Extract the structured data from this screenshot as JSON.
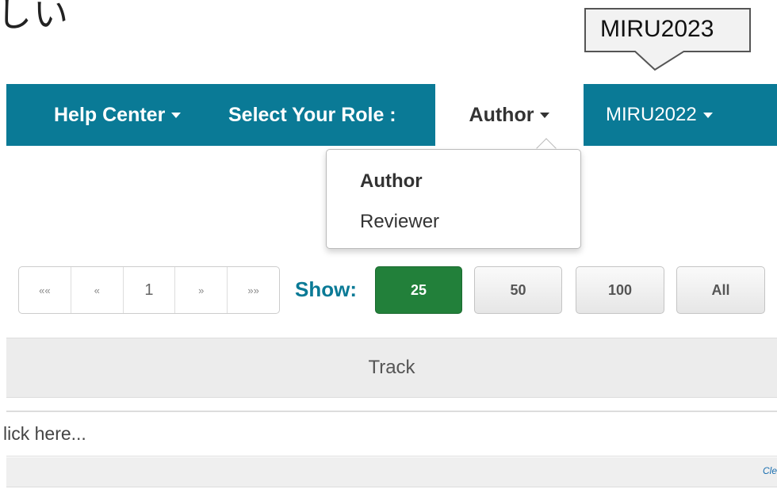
{
  "corner_text": "しい",
  "callout": {
    "text": "MIRU2023"
  },
  "navbar": {
    "help_center": "Help Center",
    "select_role_label": "Select Your Role :",
    "role_selected": "Author",
    "conference": "MIRU2022"
  },
  "role_dropdown": {
    "items": [
      "Author",
      "Reviewer"
    ]
  },
  "pagination": {
    "first": "««",
    "prev": "«",
    "page": "1",
    "next": "»",
    "last": "»»"
  },
  "show": {
    "label": "Show:",
    "options": [
      "25",
      "50",
      "100",
      "All"
    ],
    "selected": "25"
  },
  "table": {
    "column_header": "Track",
    "filter_placeholder": "lick here...",
    "clear_link": "Cle"
  },
  "colors": {
    "navbar": "#0a7a96",
    "active_button": "#22803a",
    "show_label": "#0a7a96"
  }
}
